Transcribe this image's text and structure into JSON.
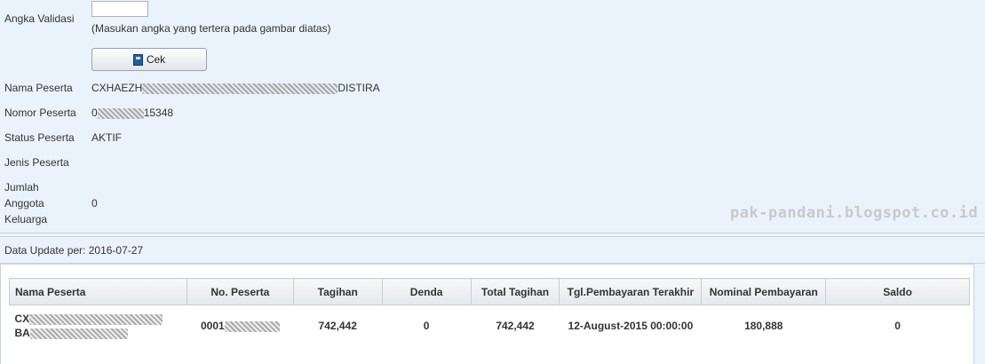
{
  "form": {
    "validation_label": "Angka Validasi",
    "validation_value": "",
    "validation_hint": "(Masukan angka yang tertera pada gambar diatas)",
    "check_button": "Cek",
    "fields": [
      {
        "label": "Nama Peserta",
        "value_prefix": "CXHAEZH",
        "value_suffix": "DISTIRA"
      },
      {
        "label": "Nomor Peserta",
        "value_prefix": "0",
        "value_suffix": "15348"
      },
      {
        "label": "Status Peserta",
        "value": "AKTIF"
      },
      {
        "label": "Jenis Peserta",
        "value": ""
      },
      {
        "label": "Jumlah Anggota Keluarga",
        "label_lines": [
          "Jumlah",
          "Anggota",
          "Keluarga"
        ],
        "value": "0"
      }
    ]
  },
  "update_text": "Data Update per: 2016-07-27",
  "watermark": "pak-pandani.blogspot.co.id",
  "table": {
    "headers": [
      "Nama Peserta",
      "No. Peserta",
      "Tagihan",
      "Denda",
      "Total Tagihan",
      "Tgl.Pembayaran Terakhir",
      "Nominal Pembayaran",
      "Saldo"
    ],
    "rows": [
      {
        "name_line1": "CX",
        "name_line2": "BA",
        "no_peserta": "0001",
        "tagihan": "742,442",
        "denda": "0",
        "total_tagihan": "742,442",
        "tgl_pembayaran": "12-August-2015 00:00:00",
        "nominal_pembayaran": "180,888",
        "saldo": "0"
      }
    ]
  }
}
